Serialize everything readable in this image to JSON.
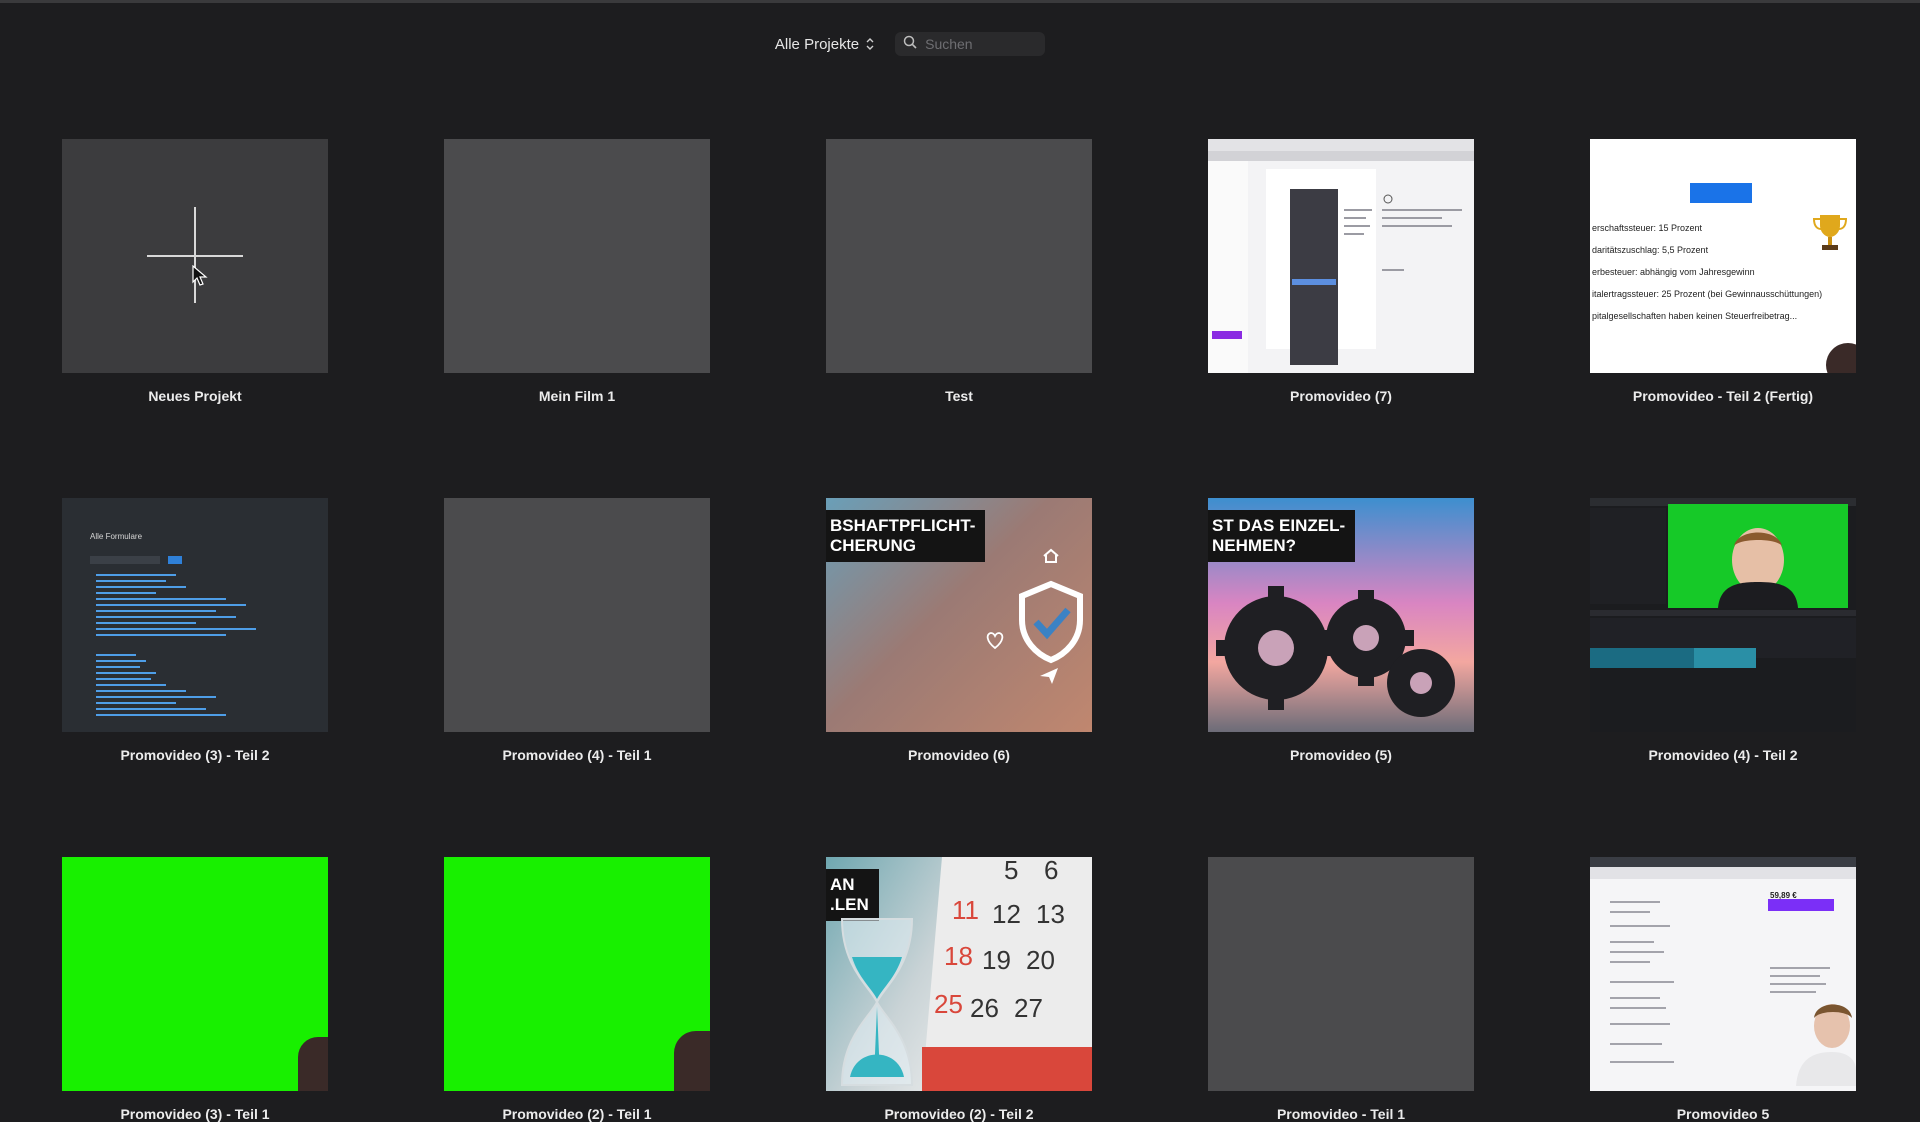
{
  "toolbar": {
    "filter_label": "Alle Projekte",
    "search_placeholder": "Suchen",
    "search_value": ""
  },
  "projects": [
    {
      "title": "Neues Projekt",
      "thumb": "new-project"
    },
    {
      "title": "Mein Film 1",
      "thumb": "empty"
    },
    {
      "title": "Test",
      "thumb": "empty"
    },
    {
      "title": "Promovideo (7)",
      "thumb": "screenshot-form"
    },
    {
      "title": "Promovideo - Teil 2 (Fertig)",
      "thumb": "screenshot-tax"
    },
    {
      "title": "Promovideo (3) - Teil 2",
      "thumb": "screenshot-dark-list"
    },
    {
      "title": "Promovideo (4) - Teil 1",
      "thumb": "empty"
    },
    {
      "title": "Promovideo (6)",
      "thumb": "photo-insurance",
      "banner": "BSHAFTPFLICHT-\nCHERUNG"
    },
    {
      "title": "Promovideo (5)",
      "thumb": "photo-gears",
      "banner": "ST DAS EINZEL-\nNEHMEN?"
    },
    {
      "title": "Promovideo (4) - Teil 2",
      "thumb": "screenshot-editor"
    },
    {
      "title": "Promovideo (3) - Teil 1",
      "thumb": "greenscreen"
    },
    {
      "title": "Promovideo (2) - Teil 1",
      "thumb": "greenscreen"
    },
    {
      "title": "Promovideo (2) - Teil 2",
      "thumb": "photo-calendar",
      "banner": "AN\n.LEN"
    },
    {
      "title": "Promovideo - Teil 1",
      "thumb": "empty"
    },
    {
      "title": "Promovideo 5",
      "thumb": "screenshot-pricing"
    }
  ],
  "thumbs_text": {
    "tax_lines": [
      "erschaftssteuer: 15 Prozent",
      "daritätszuschlag: 5,5 Prozent",
      "erbesteuer: abhängig vom Jahresgewinn",
      "italertragssteuer: 25 Prozent (bei Gewinnausschüttungen)",
      "pitalgesellschaften haben keinen Steuerfreibetrag..."
    ],
    "dark_list_title": "Alle Formulare",
    "pricing_price": "59,89 €"
  },
  "colors": {
    "background": "#1d1d1f",
    "green_screen": "#18f000",
    "accent_purple": "#7b2ff7",
    "accent_blue": "#1a73e8"
  }
}
